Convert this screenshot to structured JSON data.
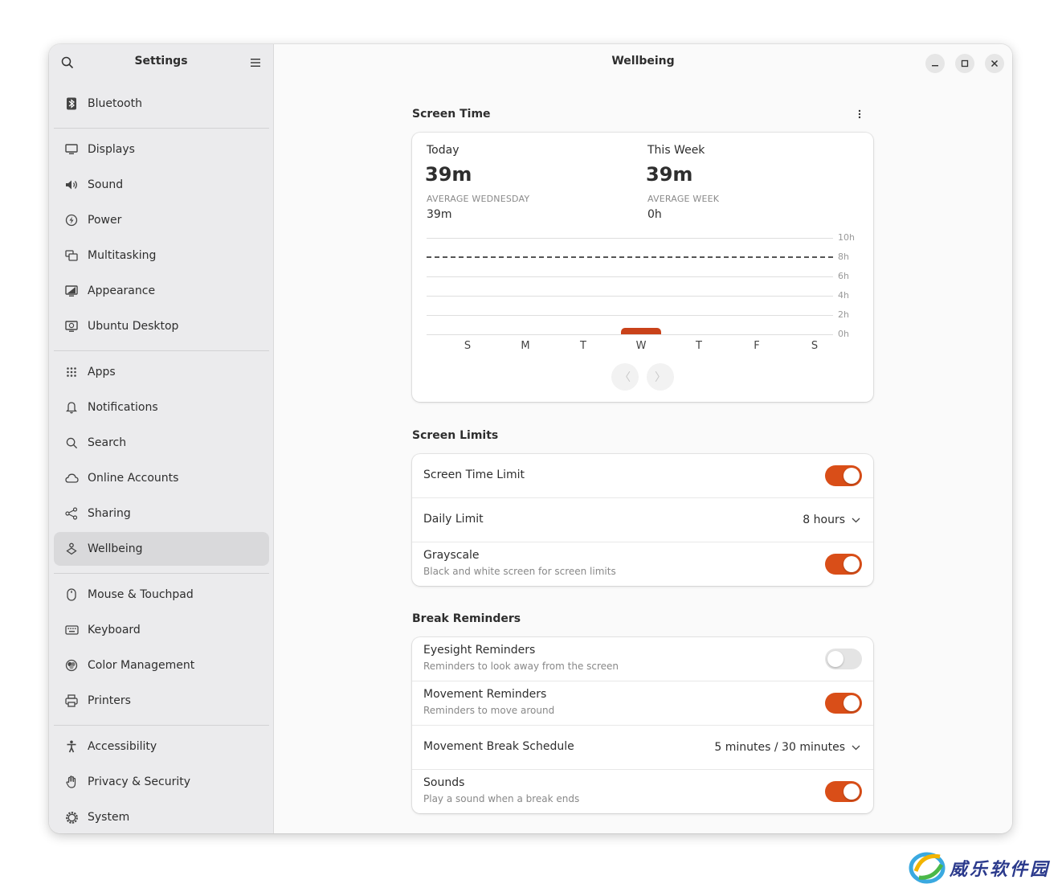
{
  "sidebar": {
    "title": "Settings",
    "items": [
      {
        "label": "Bluetooth",
        "icon": "bluetooth-icon"
      },
      {
        "label": "Displays",
        "icon": "display-icon"
      },
      {
        "label": "Sound",
        "icon": "speaker-icon"
      },
      {
        "label": "Power",
        "icon": "power-icon"
      },
      {
        "label": "Multitasking",
        "icon": "multitasking-icon"
      },
      {
        "label": "Appearance",
        "icon": "appearance-icon"
      },
      {
        "label": "Ubuntu Desktop",
        "icon": "ubuntu-desktop-icon"
      },
      {
        "label": "Apps",
        "icon": "apps-grid-icon"
      },
      {
        "label": "Notifications",
        "icon": "bell-icon"
      },
      {
        "label": "Search",
        "icon": "search-icon"
      },
      {
        "label": "Online Accounts",
        "icon": "cloud-icon"
      },
      {
        "label": "Sharing",
        "icon": "share-icon"
      },
      {
        "label": "Wellbeing",
        "icon": "wellbeing-icon",
        "selected": true
      },
      {
        "label": "Mouse & Touchpad",
        "icon": "mouse-icon"
      },
      {
        "label": "Keyboard",
        "icon": "keyboard-icon"
      },
      {
        "label": "Color Management",
        "icon": "color-icon"
      },
      {
        "label": "Printers",
        "icon": "printer-icon"
      },
      {
        "label": "Accessibility",
        "icon": "accessibility-icon"
      },
      {
        "label": "Privacy & Security",
        "icon": "hand-icon"
      },
      {
        "label": "System",
        "icon": "system-gear-icon"
      }
    ]
  },
  "page": {
    "title": "Wellbeing"
  },
  "screen_time": {
    "section_title": "Screen Time",
    "today_label": "Today",
    "today_value": "39m",
    "today_avg_caption": "AVERAGE WEDNESDAY",
    "today_avg_value": "39m",
    "week_label": "This Week",
    "week_value": "39m",
    "week_avg_caption": "AVERAGE WEEK",
    "week_avg_value": "0h"
  },
  "chart_data": {
    "type": "bar",
    "categories": [
      "S",
      "M",
      "T",
      "W",
      "T",
      "F",
      "S"
    ],
    "values": [
      0,
      0,
      0,
      0.65,
      0,
      0,
      0
    ],
    "unit": "hours",
    "ylim": [
      0,
      10
    ],
    "yticks": [
      "0h",
      "2h",
      "4h",
      "6h",
      "8h",
      "10h"
    ],
    "limit_line": 8,
    "bar_color": "#c9421a",
    "grid": true
  },
  "screen_limits": {
    "section_title": "Screen Limits",
    "screen_time_limit": {
      "label": "Screen Time Limit",
      "on": true
    },
    "daily_limit": {
      "label": "Daily Limit",
      "value": "8 hours"
    },
    "grayscale": {
      "label": "Grayscale",
      "subtitle": "Black and white screen for screen limits",
      "on": true
    }
  },
  "break_reminders": {
    "section_title": "Break Reminders",
    "eyesight": {
      "label": "Eyesight Reminders",
      "subtitle": "Reminders to look away from the screen",
      "on": false
    },
    "movement": {
      "label": "Movement Reminders",
      "subtitle": "Reminders to move around",
      "on": true
    },
    "schedule": {
      "label": "Movement Break Schedule",
      "value": "5 minutes / 30 minutes"
    },
    "sounds": {
      "label": "Sounds",
      "subtitle": "Play a sound when a break ends",
      "on": true
    }
  },
  "colors": {
    "accent": "#d94e18"
  },
  "watermark": {
    "text": "威乐软件园"
  }
}
